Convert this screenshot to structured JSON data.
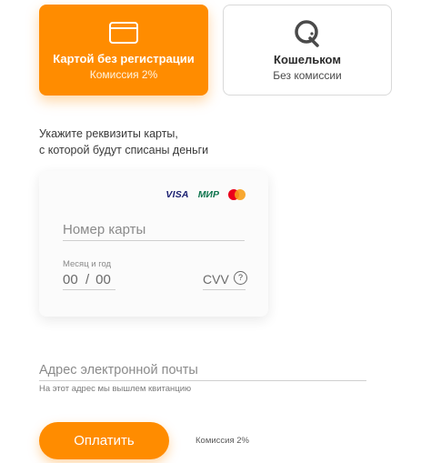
{
  "methods": {
    "card": {
      "title": "Картой без регистрации",
      "subtitle": "Комиссия 2%",
      "icon": "credit-card-icon",
      "active": true
    },
    "wallet": {
      "title": "Кошельком",
      "subtitle": "Без комиссии",
      "icon": "qiwi-logo-icon",
      "active": false
    }
  },
  "instructions": {
    "line1": "Укажите реквизиты карты,",
    "line2": "с которой будут списаны деньги"
  },
  "card_form": {
    "brands": {
      "visa": "VISA",
      "mir": "МИР",
      "mastercard_icon": "mastercard-icon"
    },
    "card_number": {
      "placeholder": "Номер карты",
      "value": ""
    },
    "expiry": {
      "label": "Месяц и год",
      "month_placeholder": "00",
      "separator": "/",
      "year_placeholder": "00"
    },
    "cvv": {
      "placeholder": "CVV",
      "help_glyph": "?"
    }
  },
  "email": {
    "placeholder": "Адрес электронной почты",
    "value": "",
    "hint": "На этот адрес мы вышлем квитанцию"
  },
  "pay": {
    "label": "Оплатить",
    "fee_note": "Комиссия 2%"
  },
  "colors": {
    "accent": "#ff8c00",
    "visa": "#1a1f71",
    "mir": "#0f754e",
    "mastercard_red": "#eb001b",
    "mastercard_yellow": "#f79e1b"
  }
}
